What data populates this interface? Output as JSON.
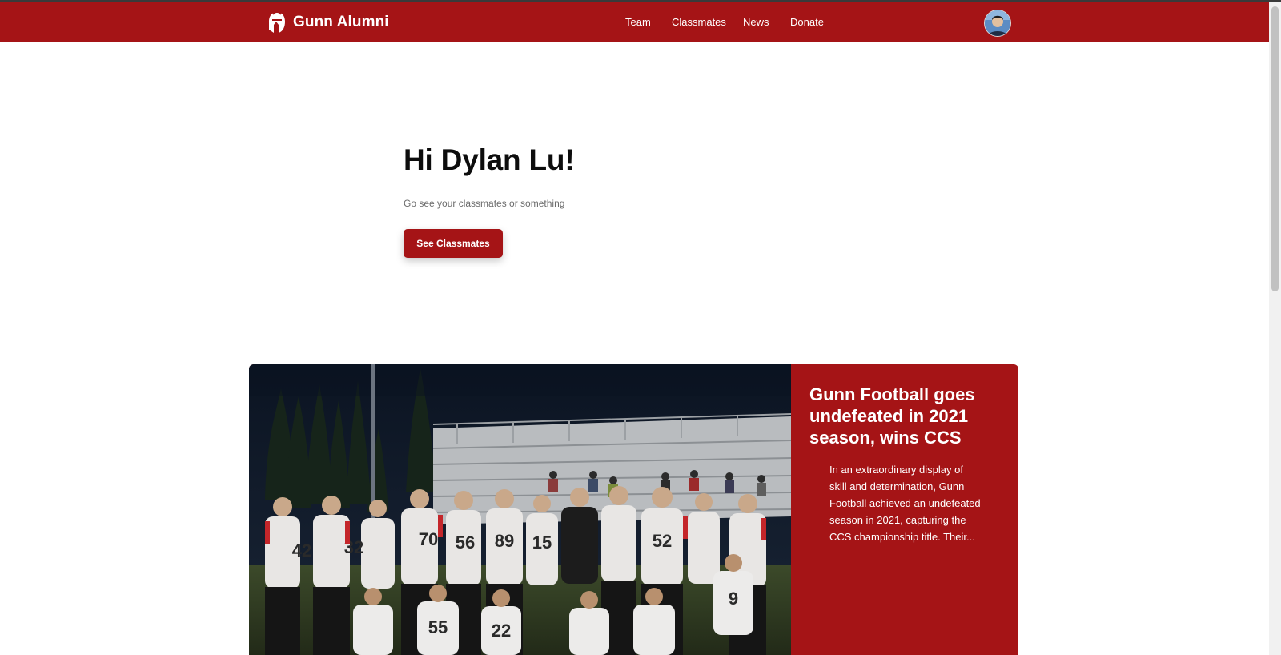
{
  "brand": {
    "name": "Gunn Alumni",
    "icon": "spartan-helmet-icon"
  },
  "nav": {
    "links": [
      {
        "label": "Team"
      },
      {
        "label": "Classmates"
      },
      {
        "label": "News"
      },
      {
        "label": "Donate"
      }
    ]
  },
  "user": {
    "avatar": "user-avatar"
  },
  "hero": {
    "greeting": "Hi Dylan Lu!",
    "subtitle": "Go see your classmates or something",
    "cta_label": "See Classmates"
  },
  "news": {
    "featured": {
      "title": "Gunn Football goes undefeated in 2021 season, wins CCS",
      "excerpt": "In an extraordinary display of skill and determination, Gunn Football achieved an undefeated season in 2021, capturing the CCS championship title. Their...",
      "jersey_numbers": [
        "42",
        "32",
        "70",
        "56",
        "89",
        "15",
        "52",
        "9",
        "22",
        "55"
      ]
    }
  },
  "colors": {
    "brand_red": "#a51416",
    "text_dark": "#0d0d0d",
    "text_muted": "#6b6b6b",
    "page_bg": "#ffffff"
  }
}
